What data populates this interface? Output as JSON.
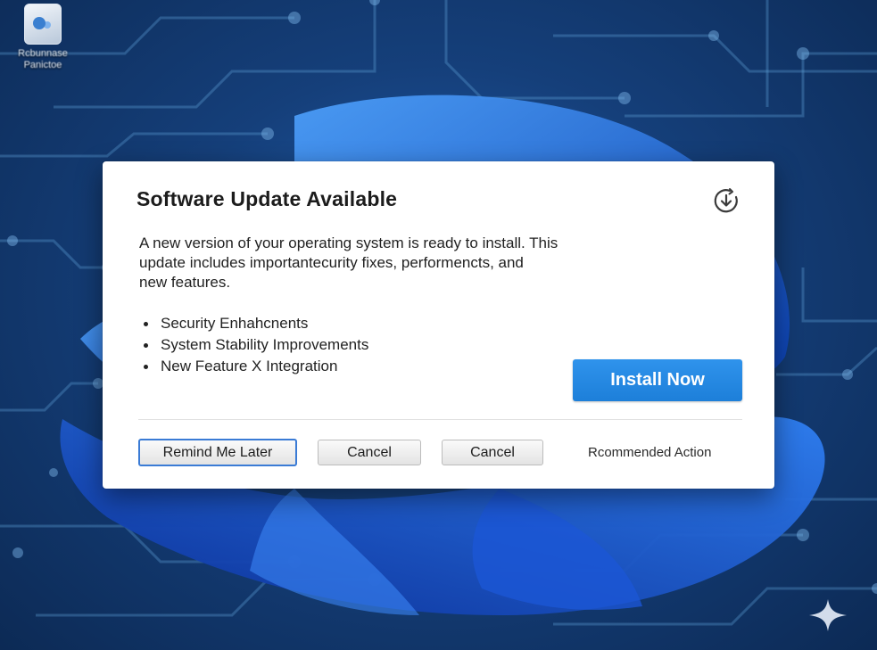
{
  "desktop": {
    "icon_label_line1": "Rcbunnase",
    "icon_label_line2": "Panictoe"
  },
  "dialog": {
    "title": "Software Update Available",
    "icon": "download-circle-icon",
    "message_lines": [
      "A new version of your operating system is ready to install. This",
      "update includes importantecurity fixes, performencts, and",
      "new features."
    ],
    "bullets": [
      "Security Enhahcnents",
      "System Stability Improvements",
      "New Feature X Integration"
    ],
    "install_label": "Install Now",
    "remind_label": "Remind Me Later",
    "cancel_label_1": "Cancel",
    "cancel_label_2": "Cancel",
    "recommended_label": "Rcommended Action"
  },
  "colors": {
    "accent": "#1d7fd9",
    "background": "#153f7a"
  }
}
